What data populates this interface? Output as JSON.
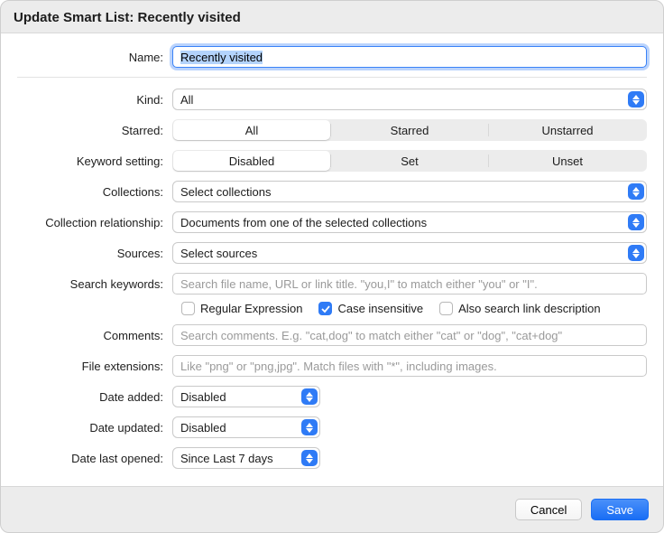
{
  "title": "Update Smart List: Recently visited",
  "labels": {
    "name": "Name:",
    "kind": "Kind:",
    "starred": "Starred:",
    "keyword_setting": "Keyword setting:",
    "collections": "Collections:",
    "collection_relationship": "Collection relationship:",
    "sources": "Sources:",
    "search_keywords": "Search keywords:",
    "comments": "Comments:",
    "file_extensions": "File extensions:",
    "date_added": "Date added:",
    "date_updated": "Date updated:",
    "date_last_opened": "Date last opened:"
  },
  "name_value": "Recently visited",
  "kind_value": "All",
  "starred_segments": {
    "a": "All",
    "b": "Starred",
    "c": "Unstarred"
  },
  "keyword_segments": {
    "a": "Disabled",
    "b": "Set",
    "c": "Unset"
  },
  "collections_value": "Select collections",
  "collection_relationship_value": "Documents from one of the selected collections",
  "sources_value": "Select sources",
  "search_keywords_placeholder": "Search file name, URL or link title. \"you,I\" to match either \"you\" or \"I\".",
  "checkboxes": {
    "regex": "Regular Expression",
    "case_insensitive": "Case insensitive",
    "also_link_desc": "Also search link description"
  },
  "comments_placeholder": "Search comments. E.g. \"cat,dog\" to match either \"cat\" or \"dog\", \"cat+dog\"",
  "file_ext_placeholder": "Like \"png\" or \"png,jpg\". Match files with \"*\", including images.",
  "date_added_value": "Disabled",
  "date_updated_value": "Disabled",
  "date_last_opened_value": "Since Last 7 days",
  "buttons": {
    "cancel": "Cancel",
    "save": "Save"
  }
}
